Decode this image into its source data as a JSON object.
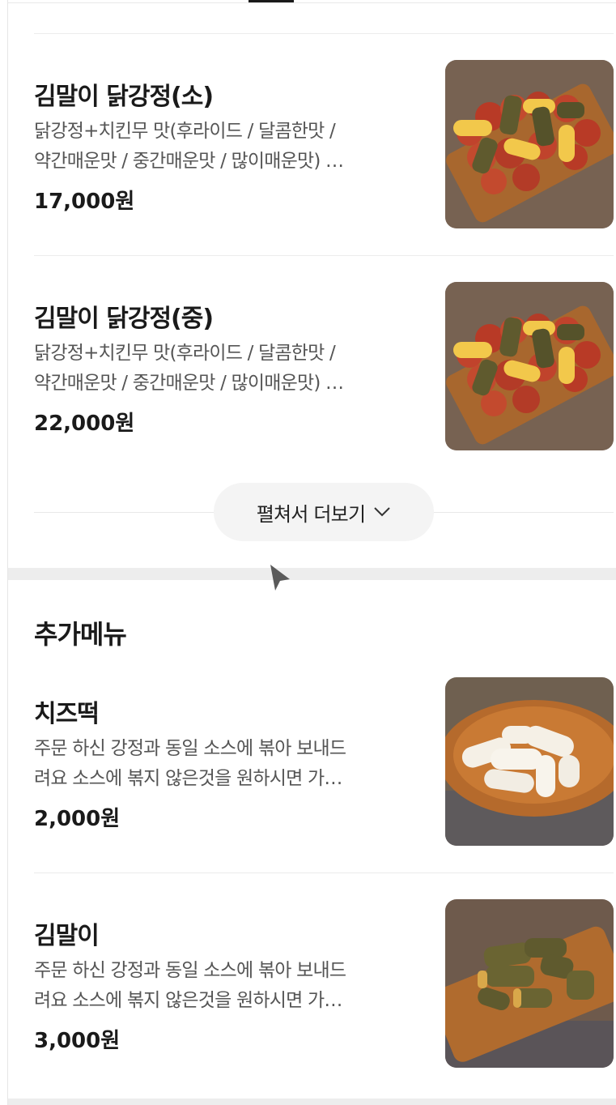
{
  "more_button": {
    "label": "펼쳐서 더보기",
    "icon": "chevron-down-icon"
  },
  "main_items": [
    {
      "name": "김말이 닭강정(소)",
      "desc_line1": "닭강정+치킨무 맛(후라이드 / 달콤한맛 /",
      "desc_line2": "약간매운맛 / 중간매운맛 / 많이매운맛) …",
      "price": "17,000원",
      "image": "fried-chicken-kimmari-photo"
    },
    {
      "name": "김말이 닭강정(중)",
      "desc_line1": "닭강정+치킨무 맛(후라이드 / 달콤한맛 /",
      "desc_line2": "약간매운맛 / 중간매운맛 / 많이매운맛) …",
      "price": "22,000원",
      "image": "fried-chicken-kimmari-photo"
    }
  ],
  "extra_section": {
    "title": "추가메뉴",
    "items": [
      {
        "name": "치즈떡",
        "desc_line1": "주문 하신 강정과 동일 소스에 볶아 보내드",
        "desc_line2": "려요 소스에 볶지 않은것을 원하시면 가…",
        "price": "2,000원",
        "image": "cheese-rice-cake-photo"
      },
      {
        "name": "김말이",
        "desc_line1": "주문 하신 강정과 동일 소스에 볶아 보내드",
        "desc_line2": "려요 소스에 볶지 않은것을 원하시면 가…",
        "price": "3,000원",
        "image": "kimmari-photo"
      }
    ]
  },
  "colors": {
    "text": "#1a1a1a",
    "desc": "#555555",
    "divider": "#ececec",
    "button_bg": "#f4f4f4"
  }
}
